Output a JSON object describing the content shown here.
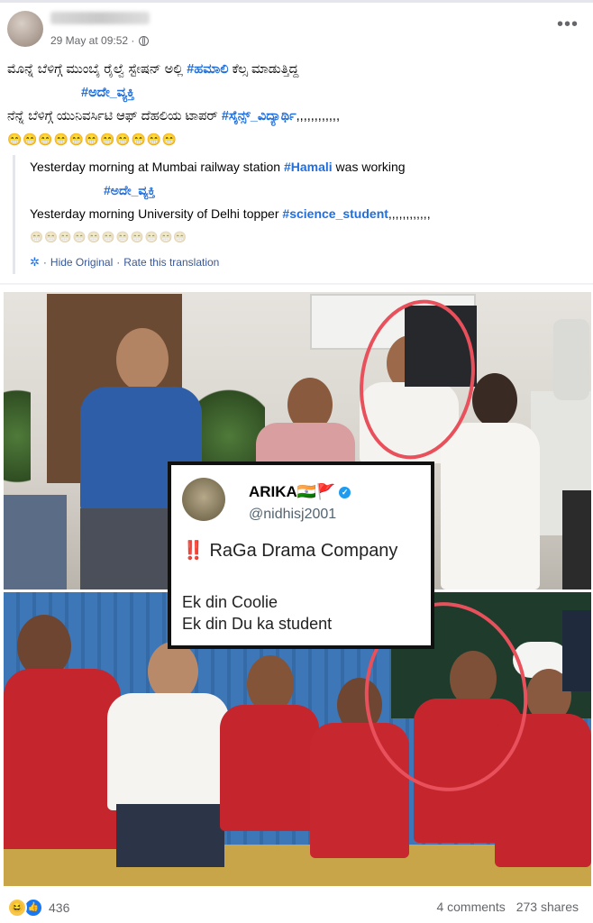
{
  "post": {
    "timestamp": "29 May at 09:52 ·",
    "more_label": "•••",
    "text": {
      "line1_prefix": "ಮೊನ್ನೆ ಬೆಳಿಗ್ಗೆ ಮುಂಬೈ ರೈಲ್ವೆ ಸ್ಟೇಷನ್ ಅಲ್ಲಿ ",
      "line1_tag": "#ಹಮಾಲಿ",
      "line1_suffix": " ಕೆಲ್ಸ ಮಾಡುತ್ತಿದ್ದ",
      "line2_tag": "#ಅದೇ_ವ್ಯಕ್ತಿ",
      "line3_prefix": "ನೆನ್ನೆ ಬೆಳಿಗ್ಗೆ ಯುನಿವರ್ಸಿಟಿ ಆಫ್ ದೆಹಲಿಯ ಟಾಪರ್ ",
      "line3_tag": "#ಸೈನ್ಸ್_ವಿದ್ಯಾರ್ಥಿ",
      "line3_suffix": ",,,,,,,,,,,,",
      "emojis": "😁😁😁😁😁😁😁😁😁😁😁"
    },
    "translation": {
      "line1_prefix": "Yesterday morning at Mumbai railway station ",
      "line1_tag": "#Hamali",
      "line1_suffix": " was working",
      "line2_tag": "#ಅದೇ_ವ್ಯಕ್ತಿ",
      "line3_prefix": "Yesterday morning University of Delhi topper ",
      "line3_tag": "#science_student",
      "line3_suffix": ",,,,,,,,,,,,",
      "emojis": "😁😁😁😁😁😁😁😁😁😁😁",
      "hide_original": "Hide Original",
      "separator": "·",
      "rate": "Rate this translation"
    }
  },
  "tweet": {
    "name": "ARIKA🇮🇳🚩",
    "handle": "@nidhisj2001",
    "headline_mark": "‼️",
    "headline": "RaGa Drama Company",
    "body_line1": "Ek din Coolie",
    "body_line2": "Ek din Du ka student"
  },
  "footer": {
    "reaction_count": "436",
    "comments": "4 comments",
    "shares": "273 shares"
  },
  "colors": {
    "hashtag": "#216fdb",
    "highlight_ring": "#e8505b",
    "muted_text": "#65676b"
  }
}
